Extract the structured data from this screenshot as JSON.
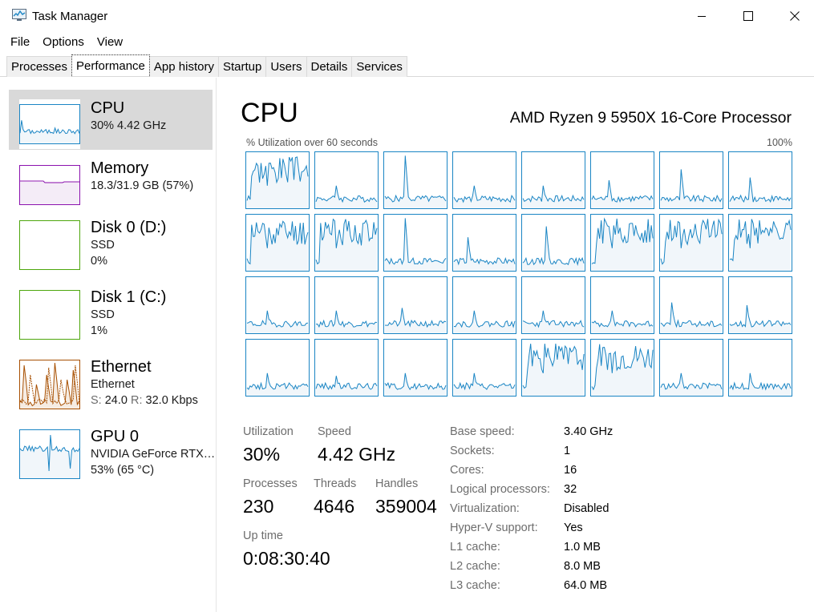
{
  "window": {
    "title": "Task Manager",
    "minimize_icon": "minimize-icon",
    "maximize_icon": "maximize-icon",
    "close_icon": "close-icon"
  },
  "menu": [
    "File",
    "Options",
    "View"
  ],
  "tabs": [
    "Processes",
    "Performance",
    "App history",
    "Startup",
    "Users",
    "Details",
    "Services"
  ],
  "active_tab": "Performance",
  "sidebar": {
    "items": [
      {
        "title": "CPU",
        "line1": "30%  4.42 GHz",
        "line2": "",
        "color": "#1a85c4",
        "selected": true
      },
      {
        "title": "Memory",
        "line1": "18.3/31.9 GB (57%)",
        "line2": "",
        "color": "#8b12ae",
        "selected": false
      },
      {
        "title": "Disk 0 (D:)",
        "line1": "SSD",
        "line2": "0%",
        "color": "#4da60c",
        "selected": false
      },
      {
        "title": "Disk 1 (C:)",
        "line1": "SSD",
        "line2": "1%",
        "color": "#4da60c",
        "selected": false
      },
      {
        "title": "Ethernet",
        "line1": "Ethernet",
        "line2": "",
        "color": "#a74f01",
        "selected": false
      },
      {
        "title": "GPU 0",
        "line1": "NVIDIA GeForce RTX…",
        "line2": "53%  (65 °C)",
        "color": "#1a85c4",
        "selected": false
      }
    ],
    "ethernet_send_label": "S:",
    "ethernet_send_value": "24.0",
    "ethernet_recv_label": "R:",
    "ethernet_recv_value": "32.0 Kbps"
  },
  "cpu": {
    "title": "CPU",
    "model": "AMD Ryzen 9 5950X 16-Core Processor",
    "graph_label": "% Utilization over 60 seconds",
    "graph_max": "100%",
    "logical_processors_shown": 32,
    "utilization_label": "Utilization",
    "utilization": "30%",
    "speed_label": "Speed",
    "speed": "4.42 GHz",
    "processes_label": "Processes",
    "processes": "230",
    "threads_label": "Threads",
    "threads": "4646",
    "handles_label": "Handles",
    "handles": "359004",
    "uptime_label": "Up time",
    "uptime": "0:08:30:40",
    "details": [
      {
        "label": "Base speed:",
        "value": "3.40 GHz"
      },
      {
        "label": "Sockets:",
        "value": "1"
      },
      {
        "label": "Cores:",
        "value": "16"
      },
      {
        "label": "Logical processors:",
        "value": "32"
      },
      {
        "label": "Virtualization:",
        "value": "Disabled"
      },
      {
        "label": "Hyper-V support:",
        "value": "Yes"
      },
      {
        "label": "L1 cache:",
        "value": "1.0 MB"
      },
      {
        "label": "L2 cache:",
        "value": "8.0 MB"
      },
      {
        "label": "L3 cache:",
        "value": "64.0 MB"
      }
    ]
  },
  "colors": {
    "cpu_line": "#1a85c4",
    "cpu_fill": "#f1f6fa",
    "memory_line": "#8b12ae",
    "disk_line": "#4da60c",
    "ethernet_line": "#a74f01",
    "selected_bg": "#d9d9d9"
  }
}
